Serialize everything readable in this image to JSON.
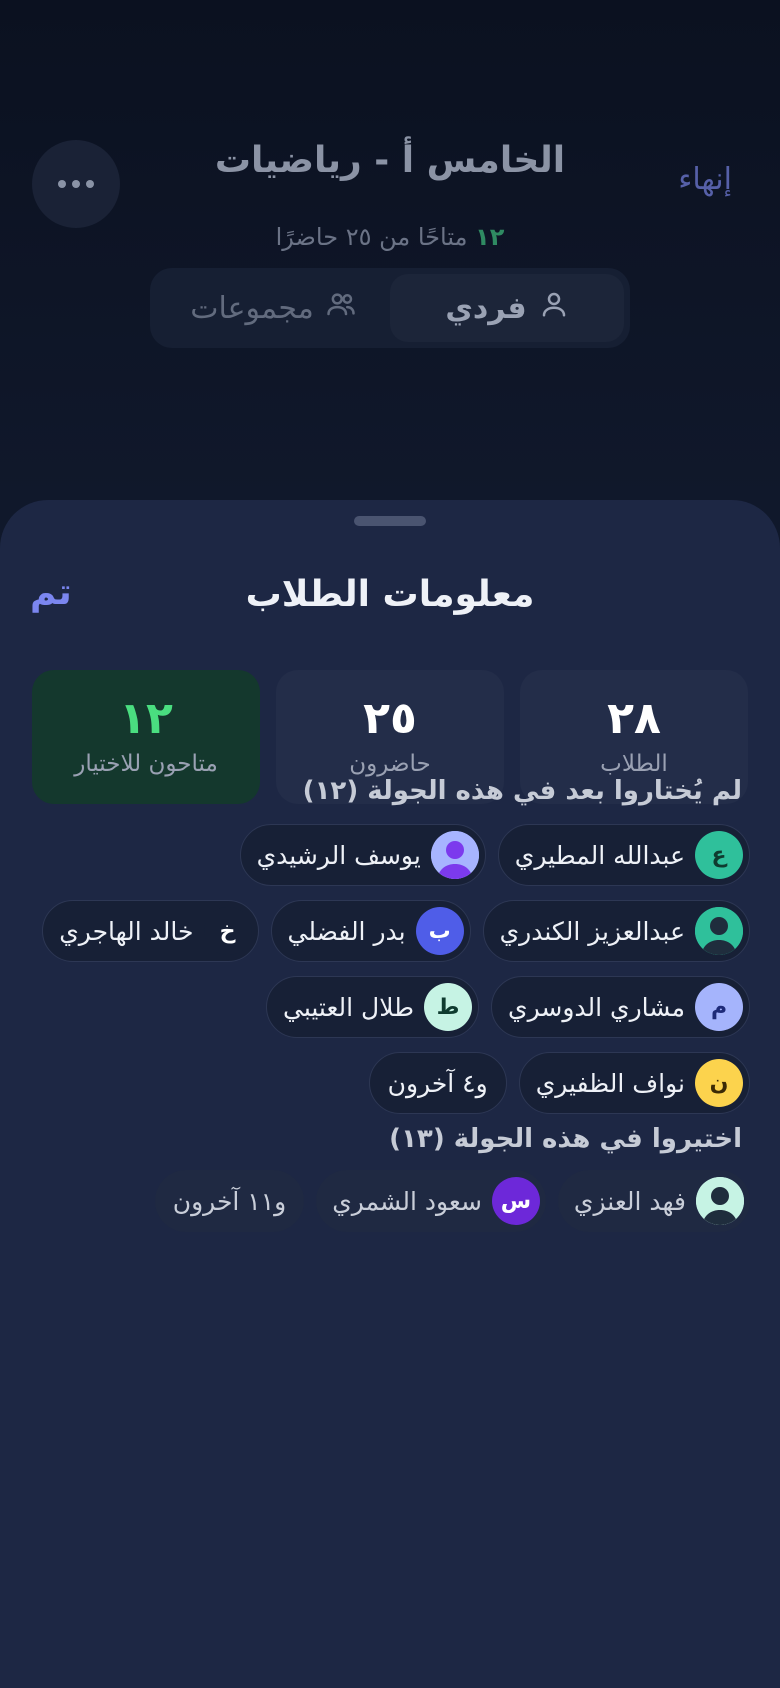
{
  "header": {
    "title": "الخامس أ - رياضيات",
    "end_label": "إنهاء",
    "available_count": "١٢",
    "available_text": "متاحًا من ٢٥ حاضرًا",
    "modes": {
      "individual": "فردي",
      "groups": "مجموعات"
    },
    "active_mode": "individual"
  },
  "sheet": {
    "title": "معلومات الطلاب",
    "done_label": "تم",
    "stats": [
      {
        "value": "٢٨",
        "label": "الطلاب"
      },
      {
        "value": "٢٥",
        "label": "حاضرون"
      },
      {
        "value": "١٢",
        "label": "متاحون للاختيار"
      }
    ],
    "not_picked": {
      "title": "لم يُختاروا بعد في هذه الجولة (١٢)",
      "students": [
        {
          "name": "عبدالله المطيري",
          "initial": "ع",
          "avatar_type": "letter",
          "color": "#2fc09b",
          "text_color": "#0f3b2f"
        },
        {
          "name": "يوسف الرشيدي",
          "initial": "",
          "avatar_type": "person",
          "color": "#a7b4ff",
          "text_color": "#7c3aed"
        },
        {
          "name": "عبدالعزيز الكندري",
          "initial": "",
          "avatar_type": "person",
          "color": "#2fc09b",
          "text_color": "#1f2d3d"
        },
        {
          "name": "بدر الفضلي",
          "initial": "ب",
          "avatar_type": "letter",
          "color": "#4f5de8",
          "text_color": "#ffffff"
        },
        {
          "name": "خالد الهاجري",
          "initial": "خ",
          "avatar_type": "letter",
          "color": "#172036",
          "text_color": "#ffffff"
        },
        {
          "name": "مشاري الدوسري",
          "initial": "م",
          "avatar_type": "letter",
          "color": "#a5b4fc",
          "text_color": "#1e2a78"
        },
        {
          "name": "طلال العتيبي",
          "initial": "ط",
          "avatar_type": "letter",
          "color": "#c6f3e4",
          "text_color": "#0f3b2f"
        },
        {
          "name": "نواف الظفيري",
          "initial": "ن",
          "avatar_type": "letter",
          "color": "#fcd34d",
          "text_color": "#3b2a05"
        }
      ],
      "more_label": "و٤ آخرون"
    },
    "picked": {
      "title": "اختيروا في هذه الجولة (١٣)",
      "students": [
        {
          "name": "فهد العنزي",
          "initial": "",
          "avatar_type": "person",
          "color": "#c6f3e4",
          "text_color": "#1f2d3d"
        },
        {
          "name": "سعود الشمري",
          "initial": "س",
          "avatar_type": "letter",
          "color": "#6d28d9",
          "text_color": "#ffffff"
        }
      ],
      "more_label": "و١١ آخرون"
    }
  }
}
